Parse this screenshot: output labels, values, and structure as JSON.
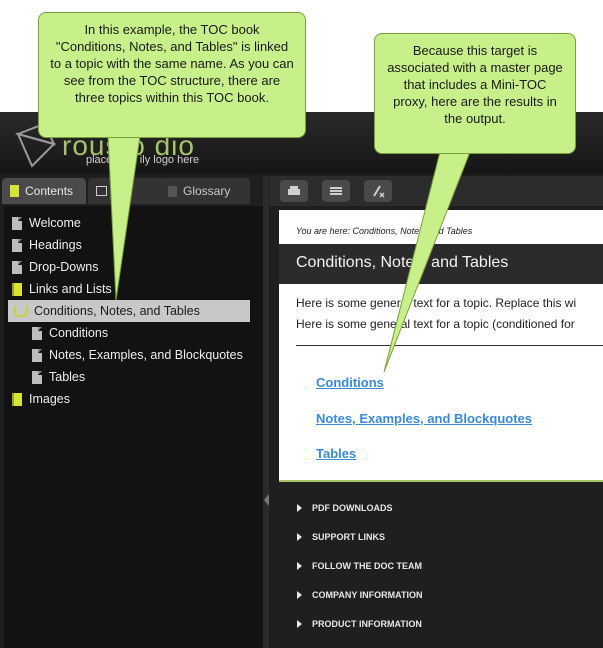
{
  "logo": {
    "text": "rousfo dio",
    "tagline": "place your ily logo here"
  },
  "nav_tabs": [
    {
      "label": "Contents",
      "icon": "contents-book-icon"
    },
    {
      "label": "In",
      "icon": "index-list-icon"
    },
    {
      "label": "Glossary",
      "icon": "glossary-icon"
    }
  ],
  "toc": [
    {
      "label": "Welcome",
      "icon": "page-icon"
    },
    {
      "label": "Headings",
      "icon": "page-icon"
    },
    {
      "label": "Drop-Downs",
      "icon": "page-icon"
    },
    {
      "label": "Links and Lists",
      "icon": "book-closed-icon"
    },
    {
      "label": "Conditions, Notes, and Tables",
      "icon": "book-open-icon",
      "selected": true
    },
    {
      "label": "Conditions",
      "icon": "page-icon"
    },
    {
      "label": "Notes, Examples, and Blockquotes",
      "icon": "page-icon"
    },
    {
      "label": "Tables",
      "icon": "page-icon"
    },
    {
      "label": "Images",
      "icon": "book-closed-icon"
    }
  ],
  "toolbar": {
    "buttons": [
      "print-icon",
      "list-icon",
      "clear-highlight-icon"
    ]
  },
  "topic": {
    "breadcrumb": "You are here: Conditions, Notes, and Tables",
    "title": "Conditions, Notes, and Tables",
    "paragraph1": "Here is some general text for a topic. Replace this wi",
    "paragraph2": "Here is some general text for a topic (conditioned for",
    "minitoc_links": [
      "Conditions",
      "Notes, Examples, and Blockquotes",
      "Tables"
    ]
  },
  "footer_items": [
    "PDF DOWNLOADS",
    "SUPPORT LINKS",
    "FOLLOW THE DOC TEAM",
    "COMPANY INFORMATION",
    "PRODUCT INFORMATION"
  ],
  "callouts": {
    "left": "In this example, the TOC book \"Conditions, Notes, and Tables\" is linked to a topic with the same name. As you can see from the TOC structure, there are three topics within this TOC book.",
    "right": "Because this target is associated with a master page that includes a Mini-TOC proxy, here are the results in the output."
  },
  "colors": {
    "callout_fill": "#c8f08a",
    "link": "#3a8ad8",
    "accent": "#a6c36a",
    "book": "#d8e336"
  }
}
